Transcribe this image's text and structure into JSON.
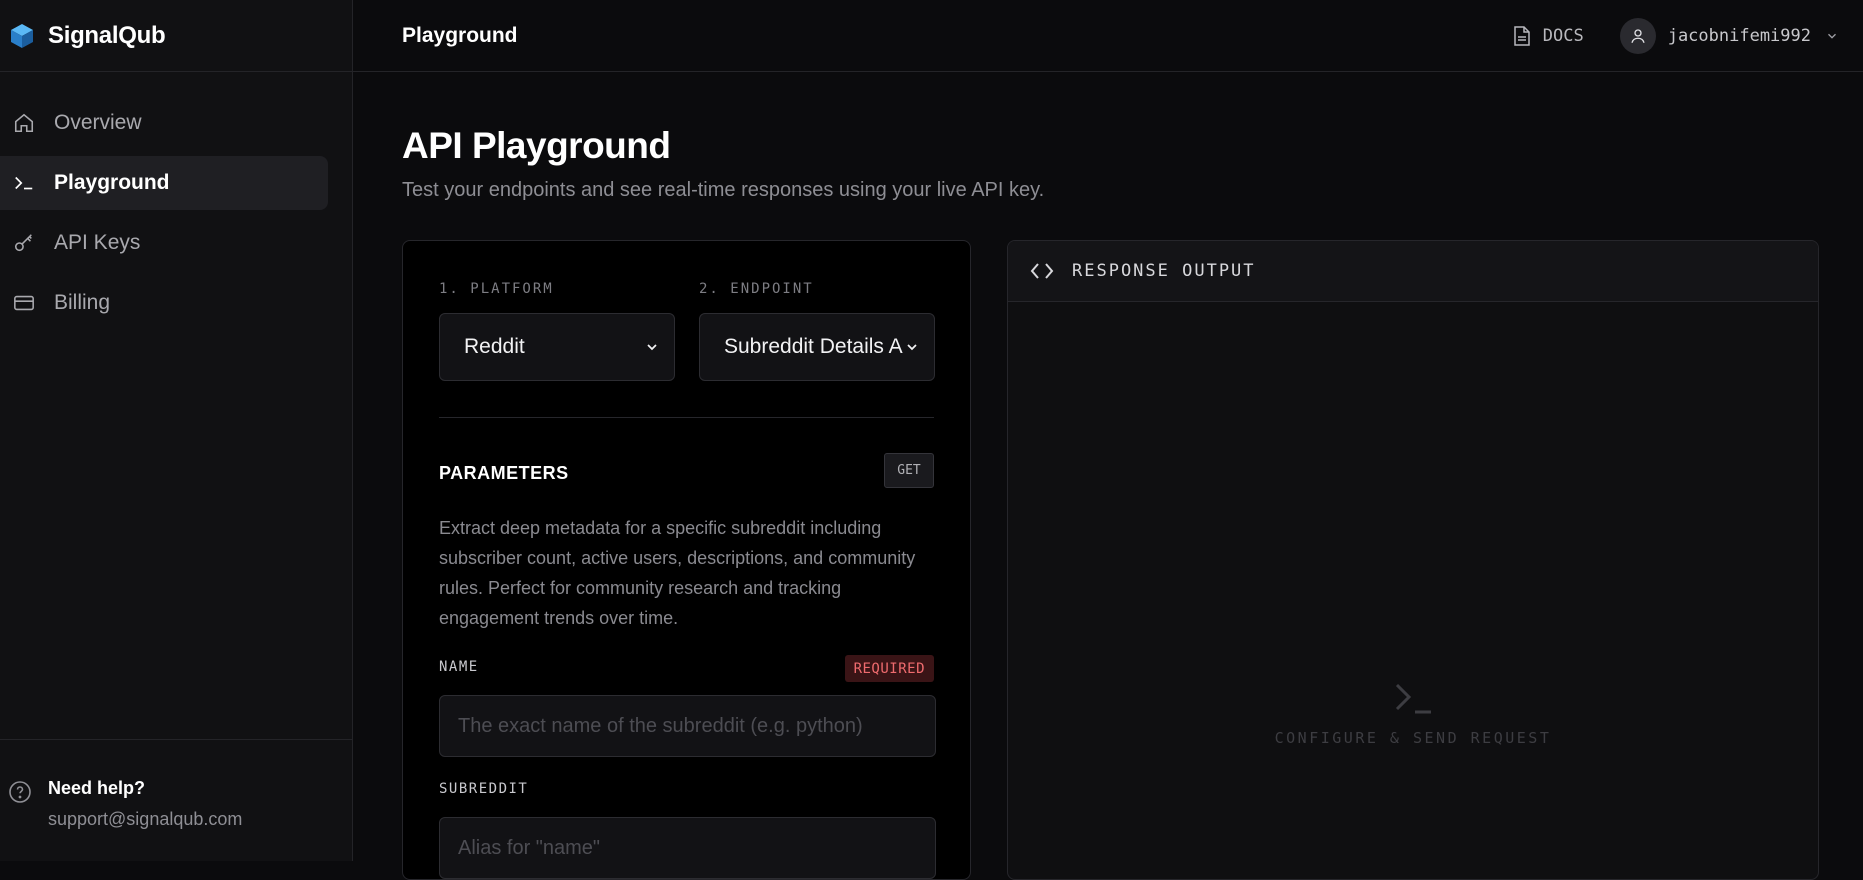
{
  "app": {
    "name": "SignalQub"
  },
  "sidebar": {
    "items": [
      {
        "label": "Overview",
        "icon": "home-icon",
        "active": false
      },
      {
        "label": "Playground",
        "icon": "terminal-icon",
        "active": true
      },
      {
        "label": "API Keys",
        "icon": "key-icon",
        "active": false
      },
      {
        "label": "Billing",
        "icon": "credit-card-icon",
        "active": false
      }
    ],
    "help": {
      "title": "Need help?",
      "email": "support@signalqub.com"
    }
  },
  "topbar": {
    "title": "Playground",
    "docs_label": "DOCS",
    "username": "jacobnifemi992"
  },
  "page": {
    "title": "API Playground",
    "subtitle": "Test your endpoints and see real-time responses using your live API key."
  },
  "form": {
    "platform_label": "1. PLATFORM",
    "platform_value": "Reddit",
    "endpoint_label": "2. ENDPOINT",
    "endpoint_value": "Subreddit Details API",
    "params_title": "PARAMETERS",
    "method": "GET",
    "description": "Extract deep metadata for a specific subreddit including subscriber count, active users, descriptions, and community rules. Perfect for community research and tracking engagement trends over time.",
    "name_label": "NAME",
    "required_badge": "REQUIRED",
    "name_placeholder": "The exact name of the subreddit (e.g. python)",
    "subreddit_label": "SUBREDDIT",
    "subreddit_placeholder": "Alias for \"name\""
  },
  "response": {
    "title": "RESPONSE OUTPUT",
    "empty_text": "CONFIGURE & SEND REQUEST"
  },
  "colors": {
    "background": "#0b0b0d",
    "sidebar": "#111113",
    "accent_logo": "#3aa0e8",
    "required": "#ef6b6e"
  }
}
